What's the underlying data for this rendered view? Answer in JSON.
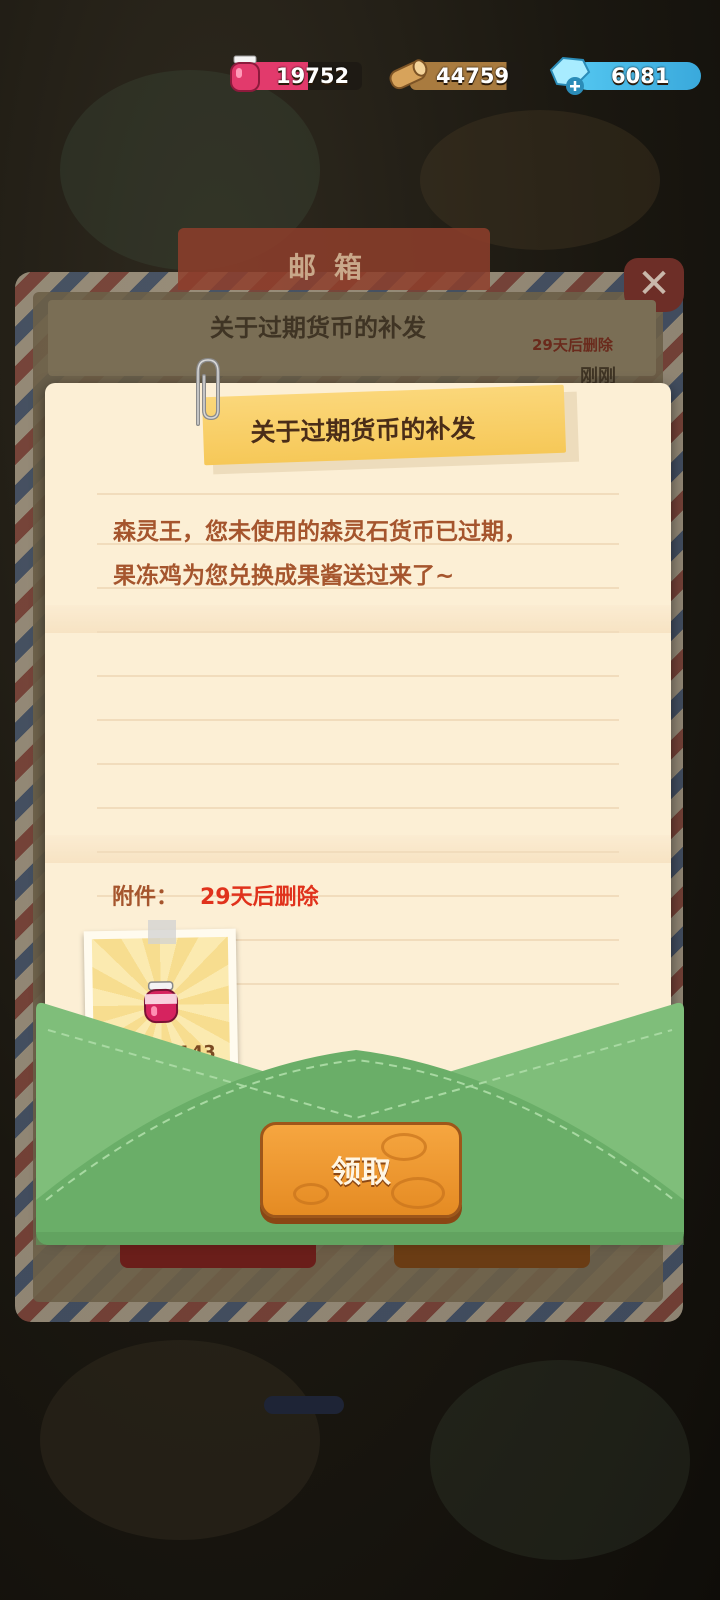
{
  "resources": {
    "jam": {
      "value": "19752",
      "icon": "jam-jar-icon",
      "color": "#e23a6c"
    },
    "wood": {
      "value": "44759",
      "icon": "wood-log-icon",
      "color": "#a97b3f"
    },
    "gem": {
      "value": "6081",
      "icon": "gem-plus-icon",
      "color": "#53c6f0"
    }
  },
  "background_panel": {
    "tab_title": "邮箱",
    "mail_row": {
      "title": "关于过期货币的补发",
      "expire": "29天后删除",
      "time": "刚刚"
    }
  },
  "letter": {
    "title": "关于过期货币的补发",
    "body_line1": "森灵王，您未使用的森灵石货币已过期，",
    "body_line2": "果冻鸡为您兑换成果酱送过来了~",
    "attachment_label": "附件：",
    "attachment_expire": "29天后删除",
    "attachment": {
      "icon": "jam-jar-icon",
      "count": "143"
    },
    "claim_button": "领取"
  },
  "colors": {
    "letter_paper": "#fcefd5",
    "text_brown": "#a5552d",
    "expire_red": "#e0321c",
    "envelope_green": "#7fbe7a",
    "button_orange": "#f0992f"
  }
}
